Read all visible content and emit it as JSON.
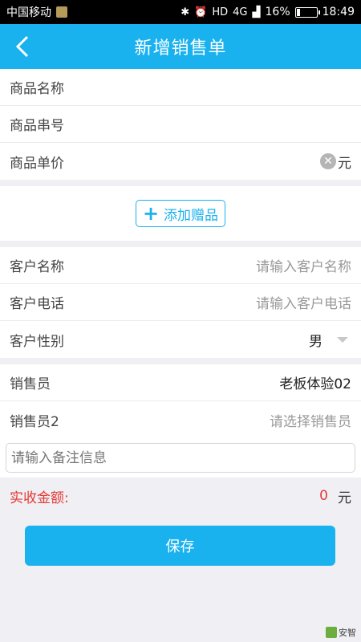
{
  "status": {
    "carrier": "中国移动",
    "network": "4G",
    "battery_percent": "16%",
    "battery_level": 0.16,
    "time": "18:49"
  },
  "header": {
    "title": "新增销售单"
  },
  "product": {
    "name_label": "商品名称",
    "serial_label": "商品串号",
    "price_label": "商品单价",
    "price_unit": "元"
  },
  "gift": {
    "button_label": "添加赠品"
  },
  "customer": {
    "name_label": "客户名称",
    "name_placeholder": "请输入客户名称",
    "phone_label": "客户电话",
    "phone_placeholder": "请输入客户电话",
    "gender_label": "客户性别",
    "gender_value": "男"
  },
  "sales": {
    "seller_label": "销售员",
    "seller_value": "老板体验02",
    "seller2_label": "销售员2",
    "seller2_placeholder": "请选择销售员"
  },
  "note": {
    "placeholder": "请输入备注信息"
  },
  "amount": {
    "label": "实收金额:",
    "value": "0",
    "unit": "元"
  },
  "save_button": "保存",
  "watermark": "安智",
  "colors": {
    "accent": "#1ab1ef",
    "amount_red": "#e53935"
  }
}
